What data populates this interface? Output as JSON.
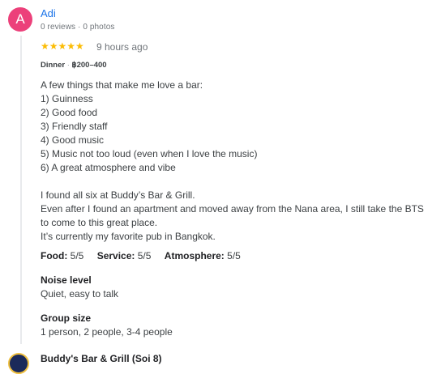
{
  "review": {
    "avatar_initial": "A",
    "reviewer_name": "Adi",
    "reviewer_meta": "0 reviews · 0 photos",
    "stars": "★★★★★",
    "time_ago": "9 hours ago",
    "meal": "Dinner",
    "price_sep": "·",
    "price_range": "฿200–400",
    "lines": [
      "A few things that make me love a bar:",
      "1) Guinness",
      "2) Good food",
      "3) Friendly staff",
      "4) Good music",
      "5) Music not too loud (even when I love the music)",
      "6) A great atmosphere and vibe",
      "",
      "I found all six at Buddy’s Bar & Grill.",
      "Even after I found an apartment and moved away from the Nana area, I still take the BTS",
      "to come to this great place.",
      "It’s currently my favorite pub in Bangkok."
    ],
    "ratings": {
      "food_label": "Food:",
      "food_value": "5/5",
      "service_label": "Service:",
      "service_value": "5/5",
      "atmosphere_label": "Atmosphere:",
      "atmosphere_value": "5/5"
    },
    "noise_label": "Noise level",
    "noise_value": "Quiet, easy to talk",
    "group_label": "Group size",
    "group_value": "1 person, 2 people, 3-4 people",
    "rating_stars_color": "#fbbc04",
    "avatar_color": "#ec407a",
    "name_color": "#1a73e8"
  },
  "owner": {
    "name": "Buddy's Bar & Grill (Soi 8)"
  }
}
